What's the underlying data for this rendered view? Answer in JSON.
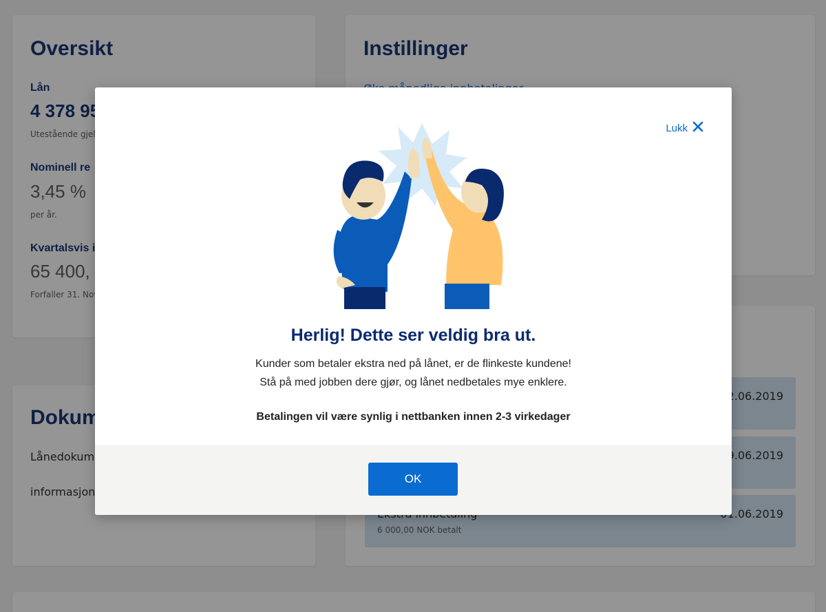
{
  "overview": {
    "title": "Oversikt",
    "loan_label": "Lån",
    "loan_value": "4 378 95",
    "loan_sub": "Utestående gjel",
    "rate_label": "Nominell re",
    "rate_value": "3,45 %",
    "rate_sub": "per år.",
    "quarterly_label": "Kvartalsvis i",
    "quarterly_value": "65 400,",
    "quarterly_sub": "Forfaller 31. Nov"
  },
  "settings": {
    "title": "Instillinger",
    "link": "Øke månedlige innbetalinger"
  },
  "documents": {
    "title": "Dokum",
    "items": [
      "Lånedokum",
      "informasjon"
    ]
  },
  "payments": [
    {
      "title": "",
      "date": "2.06.2019",
      "amount": ""
    },
    {
      "title": "",
      "date": "09.06.2019",
      "amount": ""
    },
    {
      "title": "Ekstra innbetaling",
      "date": "01.06.2019",
      "amount": "6 000,00 NOK betalt"
    }
  ],
  "modal": {
    "close_label": "Lukk",
    "heading": "Herlig! Dette ser veldig bra ut.",
    "message_line1": "Kunder som betaler ekstra ned på lånet, er de flinkeste kundene!",
    "message_line2": "Stå på med jobben dere gjør, og lånet nedbetales mye enklere.",
    "notice": "Betalingen vil være synlig i nettbanken innen 2-3 virkedager",
    "ok_label": "OK"
  },
  "colors": {
    "primary": "#0a6bd1",
    "heading": "#0a2a6e",
    "payment_bg": "#cfe3f5"
  }
}
